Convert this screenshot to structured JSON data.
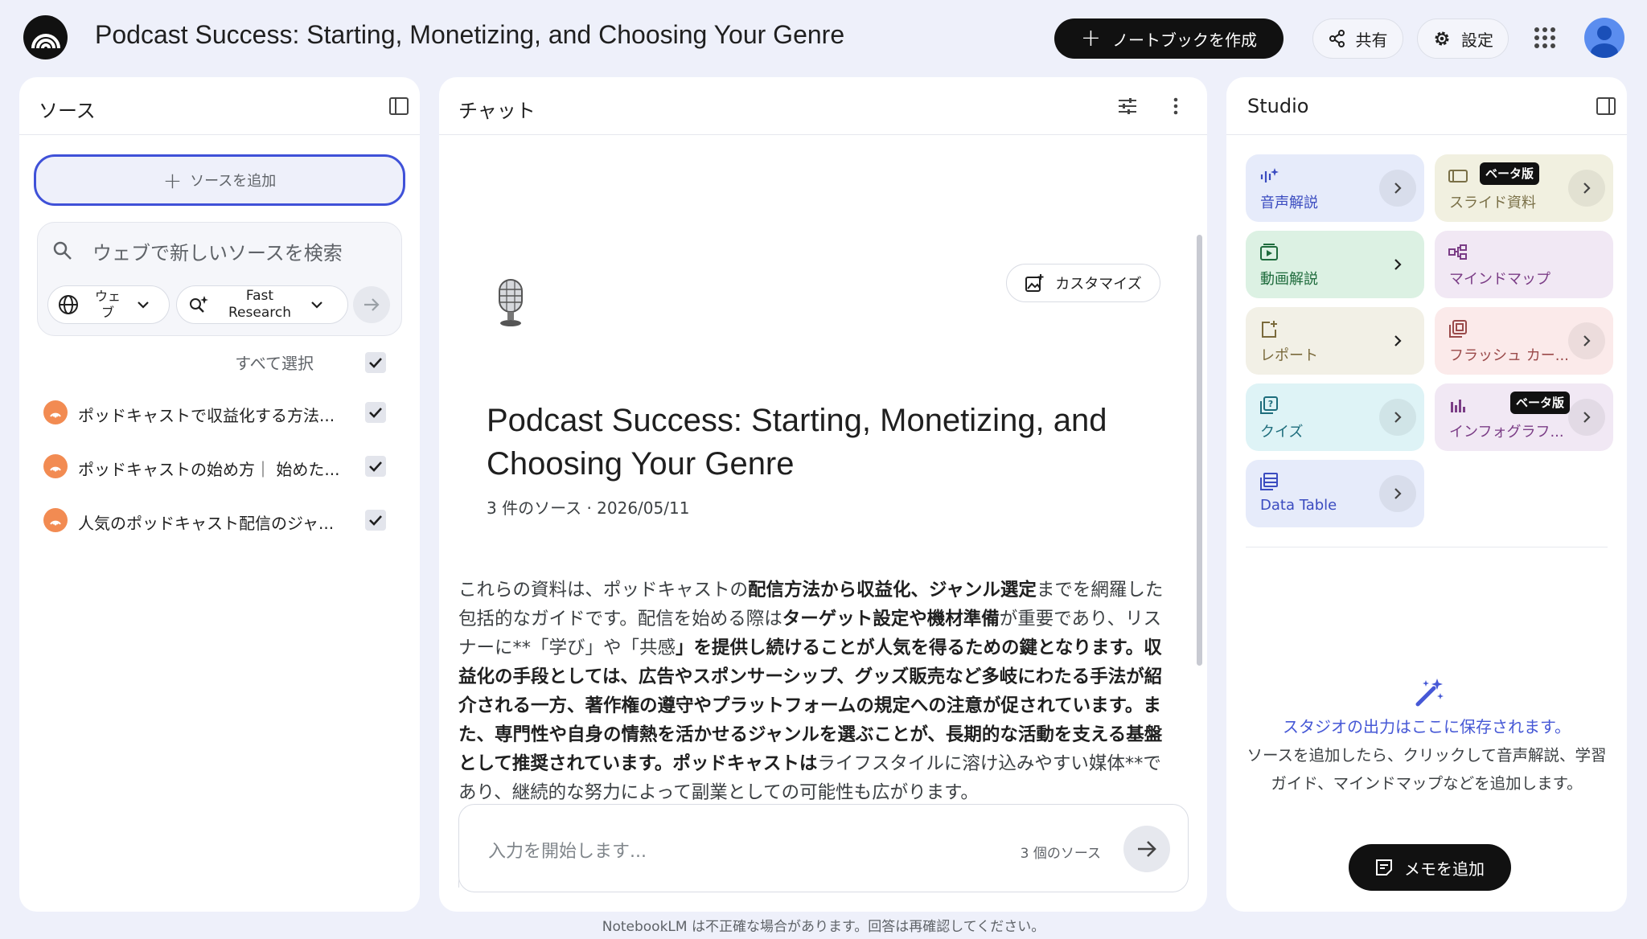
{
  "header": {
    "notebook_title": "Podcast Success: Starting, Monetizing, and Choosing Your Genre",
    "create_notebook_label": "ノートブックを作成",
    "share_label": "共有",
    "settings_label": "設定"
  },
  "sources_panel": {
    "title": "ソース",
    "add_source_label": "ソースを追加",
    "search_placeholder": "ウェブで新しいソースを検索",
    "web_chip_label": "ウェ\nブ",
    "research_chip_label": "Fast\nResearch",
    "select_all_label": "すべて選択",
    "items": [
      {
        "label": "ポッドキャストで収益化する方法...",
        "checked": true
      },
      {
        "label": "ポッドキャストの始め方｜ 始めた...",
        "checked": true
      },
      {
        "label": "人気のポッドキャスト配信のジャ...",
        "checked": true
      }
    ]
  },
  "chat_panel": {
    "title": "チャット",
    "customize_label": "カスタマイズ",
    "notebook_heading": "Podcast Success: Starting, Monetizing, and Choosing Your Genre",
    "meta": "3 件のソース · 2026/05/11",
    "summary_parts": [
      {
        "text": "これらの資料は、ポッドキャストの",
        "bold": false
      },
      {
        "text": "配信方法から収益化、ジャンル選定",
        "bold": true
      },
      {
        "text": "までを網羅した包括的なガイドです。配信を始める際は",
        "bold": false
      },
      {
        "text": "ターゲット設定や機材準備",
        "bold": true
      },
      {
        "text": "が重要であり、リスナーに**「学び」や「共感",
        "bold": false
      },
      {
        "text": "」を提供し続けることが人気を得るための鍵となります。収益化の手段としては、広告やスポンサーシップ、グッズ販売など多岐にわたる手法が紹介される一方、著作権の遵守やプラットフォームの規定への注意が促されています。また、専門性や自身の情熱を活かせるジャンルを選ぶことが、長期的な活動を支える基盤として推奨されています。ポッドキャストは",
        "bold": true
      },
      {
        "text": "ライフスタイルに溶け込みやすい媒体**であり、継続的な努力によって副業としての可能性も広がります。",
        "bold": false
      }
    ],
    "composer_placeholder": "入力を開始します...",
    "composer_source_count": "3 個のソース"
  },
  "studio_panel": {
    "title": "Studio",
    "beta_label": "ベータ版",
    "tiles": [
      {
        "label": "音声解説",
        "icon": "audio-waveform-icon"
      },
      {
        "label": "スライド資料",
        "icon": "slides-icon"
      },
      {
        "label": "動画解説",
        "icon": "video-icon"
      },
      {
        "label": "マインドマップ",
        "icon": "mindmap-icon"
      },
      {
        "label": "レポート",
        "icon": "report-icon"
      },
      {
        "label": "フラッシュ カー...",
        "icon": "flashcard-icon"
      },
      {
        "label": "クイズ",
        "icon": "quiz-icon"
      },
      {
        "label": "インフォグラフ...",
        "icon": "infographic-icon"
      },
      {
        "label": "Data Table",
        "icon": "table-icon"
      }
    ],
    "empty_title": "スタジオの出力はここに保存されます。",
    "empty_text": "ソースを追加したら、クリックして音声解説、学習ガイド、マインドマップなどを追加します。",
    "add_note_label": "メモを追加"
  },
  "footer": {
    "disclaimer": "NotebookLM は不正確な場合があります。回答は再確認してください。"
  },
  "colors": {
    "background": "#eef0fa",
    "accent": "#3f51d8",
    "source_icon": "#f28b52"
  }
}
